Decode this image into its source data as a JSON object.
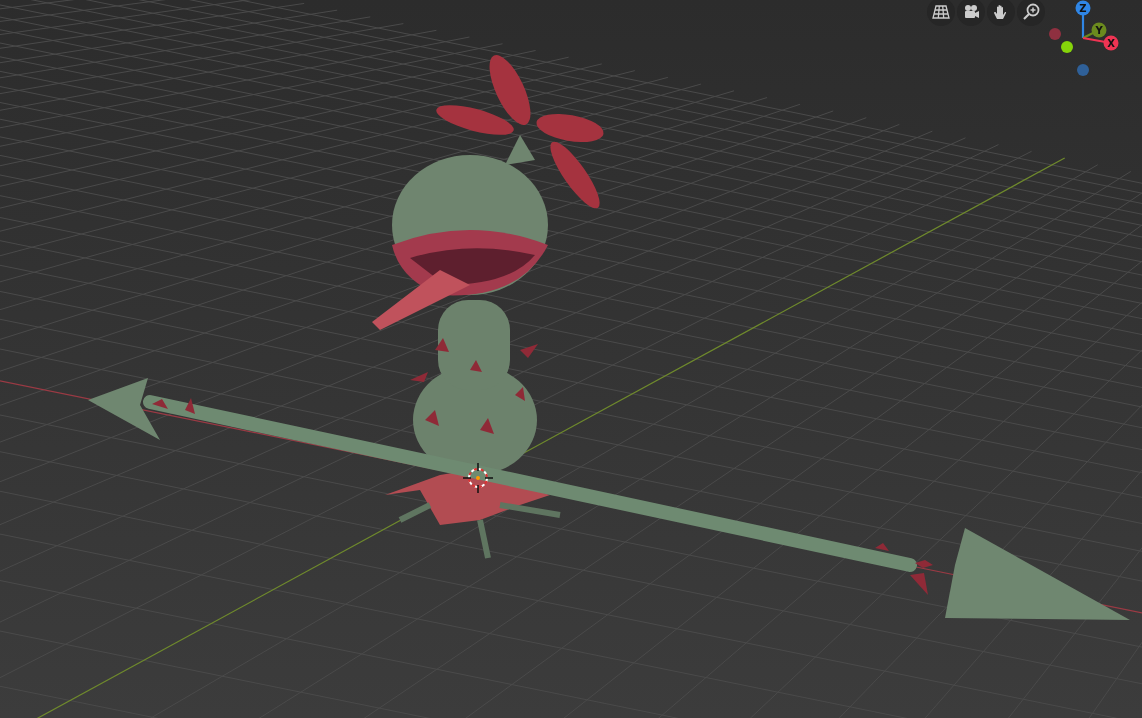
{
  "view_buttons": [
    {
      "kind": "grid"
    },
    {
      "kind": "camera"
    },
    {
      "kind": "hand"
    },
    {
      "kind": "zoom"
    }
  ],
  "gizmo": {
    "axes": [
      {
        "label": "Z",
        "color": "#2f86e6"
      },
      {
        "label": "Y",
        "color": "#6b8a1e"
      },
      {
        "label": "X",
        "color": "#ef3453"
      }
    ],
    "negative_axes": [
      {
        "color": "#8f3040"
      },
      {
        "color": "#85d40a"
      },
      {
        "color": "#2f6098"
      }
    ]
  }
}
